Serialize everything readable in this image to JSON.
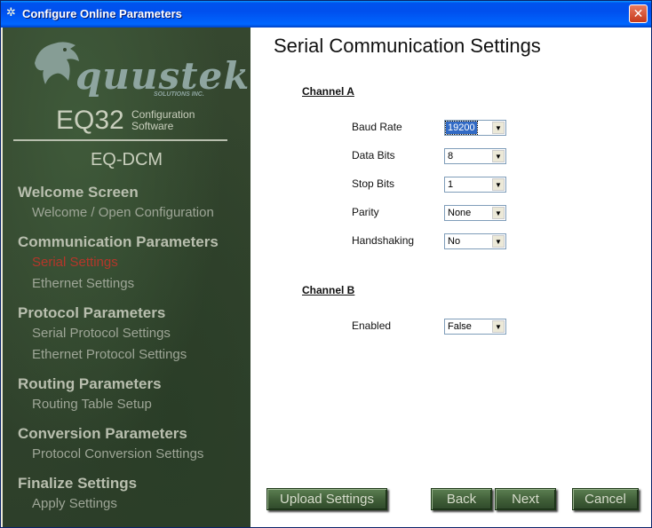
{
  "window": {
    "title": "Configure Online Parameters"
  },
  "brand": {
    "logo_word": "quustek",
    "logo_sub": "SOLUTIONS INC.",
    "product_name": "EQ32",
    "product_desc_line1": "Configuration",
    "product_desc_line2": "Software",
    "device": "EQ-DCM"
  },
  "nav": [
    {
      "heading": "Welcome Screen",
      "items": [
        "Welcome / Open Configuration"
      ]
    },
    {
      "heading": "Communication Parameters",
      "items": [
        "Serial Settings",
        "Ethernet Settings"
      ]
    },
    {
      "heading": "Protocol Parameters",
      "items": [
        "Serial Protocol Settings",
        "Ethernet Protocol Settings"
      ]
    },
    {
      "heading": "Routing Parameters",
      "items": [
        "Routing Table Setup"
      ]
    },
    {
      "heading": "Conversion Parameters",
      "items": [
        "Protocol Conversion Settings"
      ]
    },
    {
      "heading": "Finalize Settings",
      "items": [
        "Apply Settings"
      ]
    }
  ],
  "active_nav_item": "Serial Settings",
  "content": {
    "title": "Serial Communication Settings",
    "channel_a": {
      "heading": "Channel A",
      "fields": {
        "baud_rate": {
          "label": "Baud Rate",
          "value": "19200"
        },
        "data_bits": {
          "label": "Data Bits",
          "value": "8"
        },
        "stop_bits": {
          "label": "Stop Bits",
          "value": "1"
        },
        "parity": {
          "label": "Parity",
          "value": "None"
        },
        "handshaking": {
          "label": "Handshaking",
          "value": "No"
        }
      }
    },
    "channel_b": {
      "heading": "Channel B",
      "fields": {
        "enabled": {
          "label": "Enabled",
          "value": "False"
        }
      }
    }
  },
  "buttons": {
    "upload": "Upload Settings",
    "back": "Back",
    "next": "Next",
    "cancel": "Cancel"
  },
  "colors": {
    "sidebar_bg": "#35472f",
    "active_nav": "#b5362a",
    "titlebar": "#0053ee"
  }
}
